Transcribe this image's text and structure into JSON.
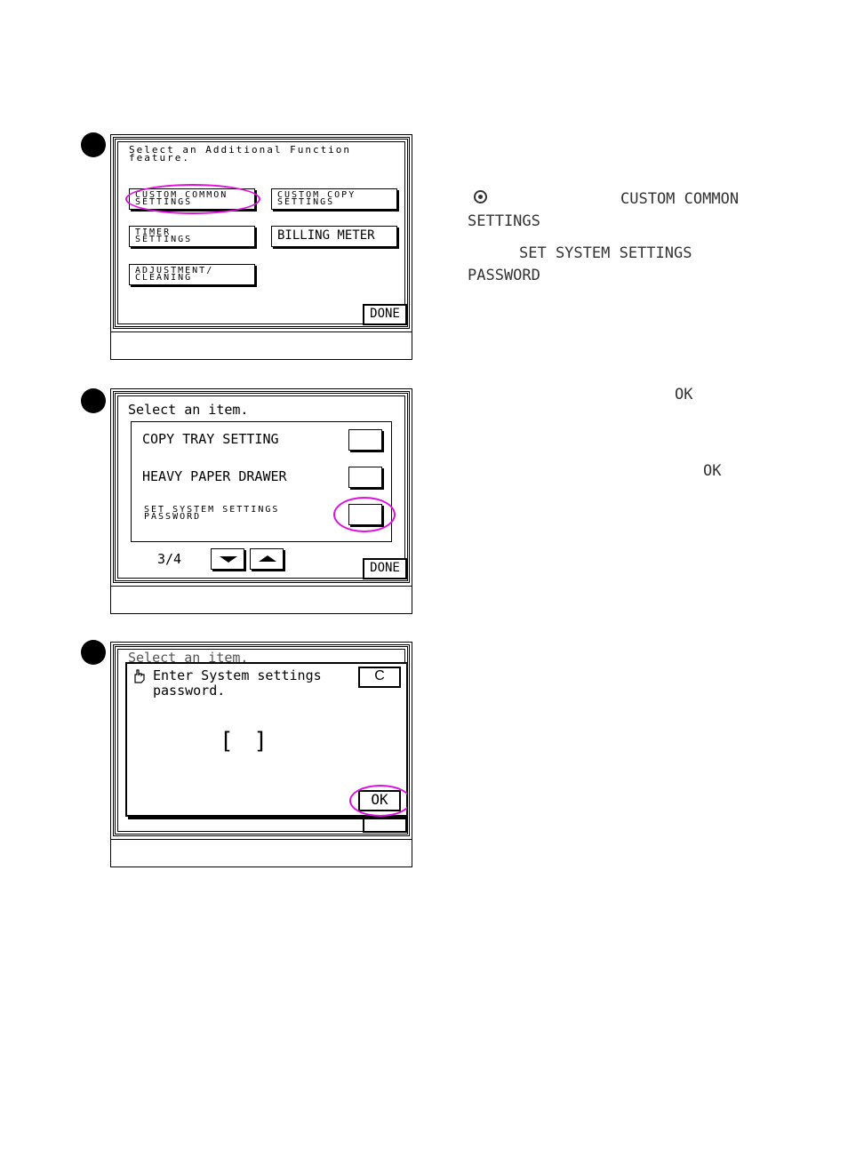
{
  "steps": [
    {
      "panel": {
        "prompt": "Select an Additional Function\nfeature.",
        "buttons": {
          "custom_common": "CUSTOM COMMON\nSETTINGS",
          "custom_copy": "CUSTOM COPY\nSETTINGS",
          "timer": "TIMER\nSETTINGS",
          "billing_meter": "BILLING METER",
          "adjustment": "ADJUSTMENT/\nCLEANING"
        },
        "done_label": "DONE"
      },
      "side_text": {
        "line1": "CUSTOM COMMON",
        "line2": "SETTINGS",
        "line3": "SET SYSTEM SETTINGS",
        "line4": "PASSWORD"
      }
    },
    {
      "panel": {
        "prompt": "Select an item.",
        "items": [
          {
            "label": "COPY TRAY SETTING"
          },
          {
            "label": "HEAVY PAPER DRAWER"
          },
          {
            "label": "SET SYSTEM SETTINGS\nPASSWORD"
          }
        ],
        "page_indicator": "3/4",
        "done_label": "DONE"
      },
      "side_text": {
        "ok1": "OK",
        "ok2": "OK"
      }
    },
    {
      "panel": {
        "background_prompt": "Select an item.",
        "dialog_title_line1": "Enter System settings",
        "dialog_title_line2": "password.",
        "clear_label": "C",
        "password_field_open": "[",
        "password_field_close": "]",
        "ok_label": "OK"
      }
    }
  ],
  "colors": {
    "highlight": "#e10ee1",
    "ink": "#000000",
    "side_text": "#333333"
  },
  "icons": [
    "gear-icon",
    "hand-pointer-icon"
  ]
}
